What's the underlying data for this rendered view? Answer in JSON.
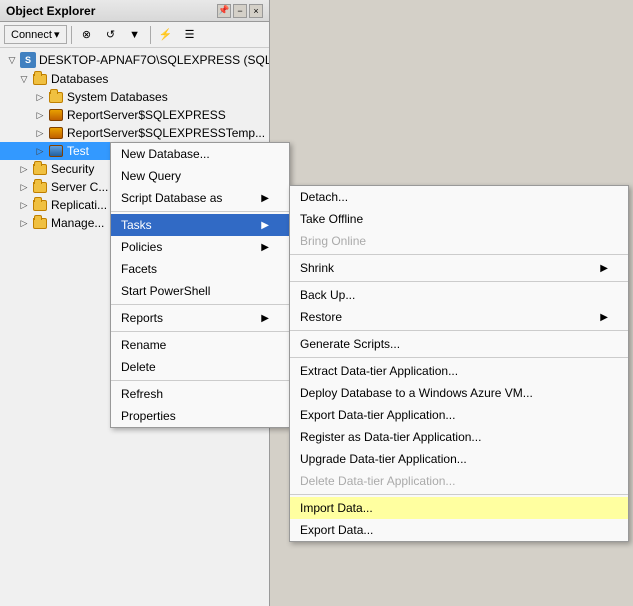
{
  "panel": {
    "title": "Object Explorer",
    "toolbar": {
      "connect_label": "Connect",
      "connect_dropdown": "▾"
    }
  },
  "tree": {
    "server": "DESKTOP-APNAF7O\\SQLEXPRESS (SQL...",
    "items": [
      {
        "label": "Databases",
        "level": 1,
        "expanded": true
      },
      {
        "label": "System Databases",
        "level": 2,
        "expanded": false
      },
      {
        "label": "ReportServer$SQLEXPRESS",
        "level": 2,
        "expanded": false
      },
      {
        "label": "ReportServer$SQLEXPRESSTemp...",
        "level": 2,
        "expanded": false
      },
      {
        "label": "Test",
        "level": 2,
        "expanded": false,
        "selected": true
      },
      {
        "label": "Security",
        "level": 1,
        "expanded": false
      },
      {
        "label": "Server C...",
        "level": 1,
        "expanded": false
      },
      {
        "label": "Replicati...",
        "level": 1,
        "expanded": false
      },
      {
        "label": "Manage...",
        "level": 1,
        "expanded": false
      }
    ]
  },
  "context_menu": {
    "items": [
      {
        "label": "New Database...",
        "has_arrow": false,
        "disabled": false
      },
      {
        "label": "New Query",
        "has_arrow": false,
        "disabled": false
      },
      {
        "label": "Script Database as",
        "has_arrow": true,
        "disabled": false
      },
      {
        "label": "Tasks",
        "has_arrow": true,
        "disabled": false,
        "highlighted": true
      },
      {
        "label": "Policies",
        "has_arrow": true,
        "disabled": false
      },
      {
        "label": "Facets",
        "has_arrow": false,
        "disabled": false
      },
      {
        "label": "Start PowerShell",
        "has_arrow": false,
        "disabled": false
      },
      {
        "label": "Reports",
        "has_arrow": true,
        "disabled": false
      },
      {
        "label": "Rename",
        "has_arrow": false,
        "disabled": false
      },
      {
        "label": "Delete",
        "has_arrow": false,
        "disabled": false
      },
      {
        "label": "Refresh",
        "has_arrow": false,
        "disabled": false
      },
      {
        "label": "Properties",
        "has_arrow": false,
        "disabled": false
      }
    ]
  },
  "submenu_tasks": {
    "items": [
      {
        "label": "Detach...",
        "has_arrow": false,
        "disabled": false
      },
      {
        "label": "Take Offline",
        "has_arrow": false,
        "disabled": false
      },
      {
        "label": "Bring Online",
        "has_arrow": false,
        "disabled": true
      },
      {
        "label": "Shrink",
        "has_arrow": true,
        "disabled": false
      },
      {
        "label": "Back Up...",
        "has_arrow": false,
        "disabled": false
      },
      {
        "label": "Restore",
        "has_arrow": true,
        "disabled": false
      },
      {
        "label": "Generate Scripts...",
        "has_arrow": false,
        "disabled": false
      },
      {
        "label": "Extract Data-tier Application...",
        "has_arrow": false,
        "disabled": false
      },
      {
        "label": "Deploy Database to a Windows Azure VM...",
        "has_arrow": false,
        "disabled": false
      },
      {
        "label": "Export Data-tier Application...",
        "has_arrow": false,
        "disabled": false
      },
      {
        "label": "Register as Data-tier Application...",
        "has_arrow": false,
        "disabled": false
      },
      {
        "label": "Upgrade Data-tier Application...",
        "has_arrow": false,
        "disabled": false
      },
      {
        "label": "Delete Data-tier Application...",
        "has_arrow": false,
        "disabled": true
      },
      {
        "label": "Import Data...",
        "has_arrow": false,
        "disabled": false,
        "highlighted": true
      },
      {
        "label": "Export Data...",
        "has_arrow": false,
        "disabled": false
      }
    ]
  },
  "colors": {
    "menu_highlight": "#316ac5",
    "import_highlight": "#ffffa0",
    "folder": "#f0c040"
  }
}
